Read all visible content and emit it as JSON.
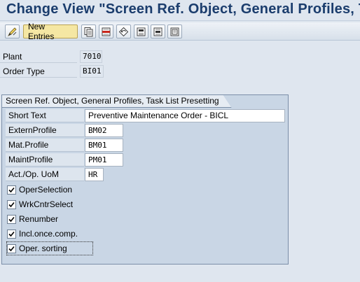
{
  "window": {
    "title": "Change View \"Screen Ref. Object, General Profiles, Tas"
  },
  "toolbar": {
    "new_entries_label": "New Entries",
    "icons": [
      "edit-toggle-icon",
      "copy-icon",
      "delete-icon",
      "undo-icon",
      "select-all-icon",
      "select-block-icon",
      "deselect-all-icon"
    ]
  },
  "header_fields": {
    "plant_label": "Plant",
    "plant_value": "7010",
    "order_type_label": "Order Type",
    "order_type_value": "BI01"
  },
  "group": {
    "title": "Screen Ref. Object, General Profiles, Task List Presetting",
    "fields": {
      "short_text_label": "Short Text",
      "short_text_value": "Preventive Maintenance Order - BICL",
      "extern_profile_label": "ExternProfile",
      "extern_profile_value": "BM02",
      "mat_profile_label": "Mat.Profile",
      "mat_profile_value": "BM01",
      "maint_profile_label": "MaintProfile",
      "maint_profile_value": "PM01",
      "act_op_uom_label": "Act./Op. UoM",
      "act_op_uom_value": "HR"
    },
    "checkboxes": [
      {
        "label": "OperSelection",
        "checked": true
      },
      {
        "label": "WrkCntrSelect",
        "checked": true
      },
      {
        "label": "Renumber",
        "checked": true
      },
      {
        "label": "Incl.once.comp.",
        "checked": true
      },
      {
        "label": "Oper. sorting",
        "checked": true
      }
    ]
  },
  "colors": {
    "title_text": "#1b3d6d",
    "background": "#dfe6ef",
    "group_background": "#c9d6e5",
    "highlight_button": "#f5e7a3"
  }
}
